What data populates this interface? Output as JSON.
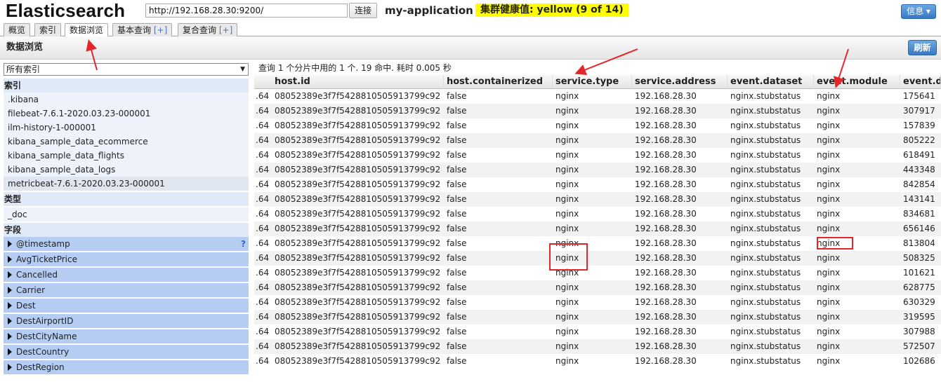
{
  "header": {
    "app_title": "Elasticsearch",
    "url_value": "http://192.168.28.30:9200/",
    "connect_label": "连接",
    "cluster_name": "my-application",
    "health_text": "集群健康值: yellow (9 of 14)",
    "info_label": "信息 ▾",
    "health_color": "#ffff00"
  },
  "tabs": [
    {
      "label": "概览",
      "plus": ""
    },
    {
      "label": "索引",
      "plus": ""
    },
    {
      "label": "数据浏览",
      "plus": ""
    },
    {
      "label": "基本查询",
      "plus": "[+]"
    },
    {
      "label": "复合查询",
      "plus": "[+]"
    }
  ],
  "section": {
    "title": "数据浏览",
    "refresh_label": "刷新"
  },
  "sidebar": {
    "index_select_value": "所有索引",
    "index_heading": "索引",
    "indices": [
      ".kibana",
      "filebeat-7.6.1-2020.03.23-000001",
      "ilm-history-1-000001",
      "kibana_sample_data_ecommerce",
      "kibana_sample_data_flights",
      "kibana_sample_data_logs",
      "metricbeat-7.6.1-2020.03.23-000001"
    ],
    "type_heading": "类型",
    "types": [
      "_doc"
    ],
    "field_heading": "字段",
    "fields": [
      "@timestamp",
      "AvgTicketPrice",
      "Cancelled",
      "Carrier",
      "Dest",
      "DestAirportID",
      "DestCityName",
      "DestCountry",
      "DestRegion"
    ],
    "field_help": "?"
  },
  "results": {
    "summary": "查询 1 个分片中用的 1 个. 19 命中. 耗时 0.005 秒",
    "columns": [
      "host.id",
      "host.containerized",
      "service.type",
      "service.address",
      "event.dataset",
      "event.module",
      "event.du"
    ],
    "partial_prefix": ".64",
    "host_id": "08052389e3f7f5428810505913799c92",
    "containerized": "false",
    "service_type": "nginx",
    "service_address": "192.168.28.30",
    "dataset": "nginx.stubstatus",
    "module": "nginx",
    "durations": [
      "175641",
      "307917",
      "157839",
      "805222",
      "618491",
      "443348",
      "842854",
      "143141",
      "834681",
      "656146",
      "813804",
      "508325",
      "101621",
      "628775",
      "630329",
      "319595",
      "307988",
      "572507",
      "102686"
    ]
  }
}
